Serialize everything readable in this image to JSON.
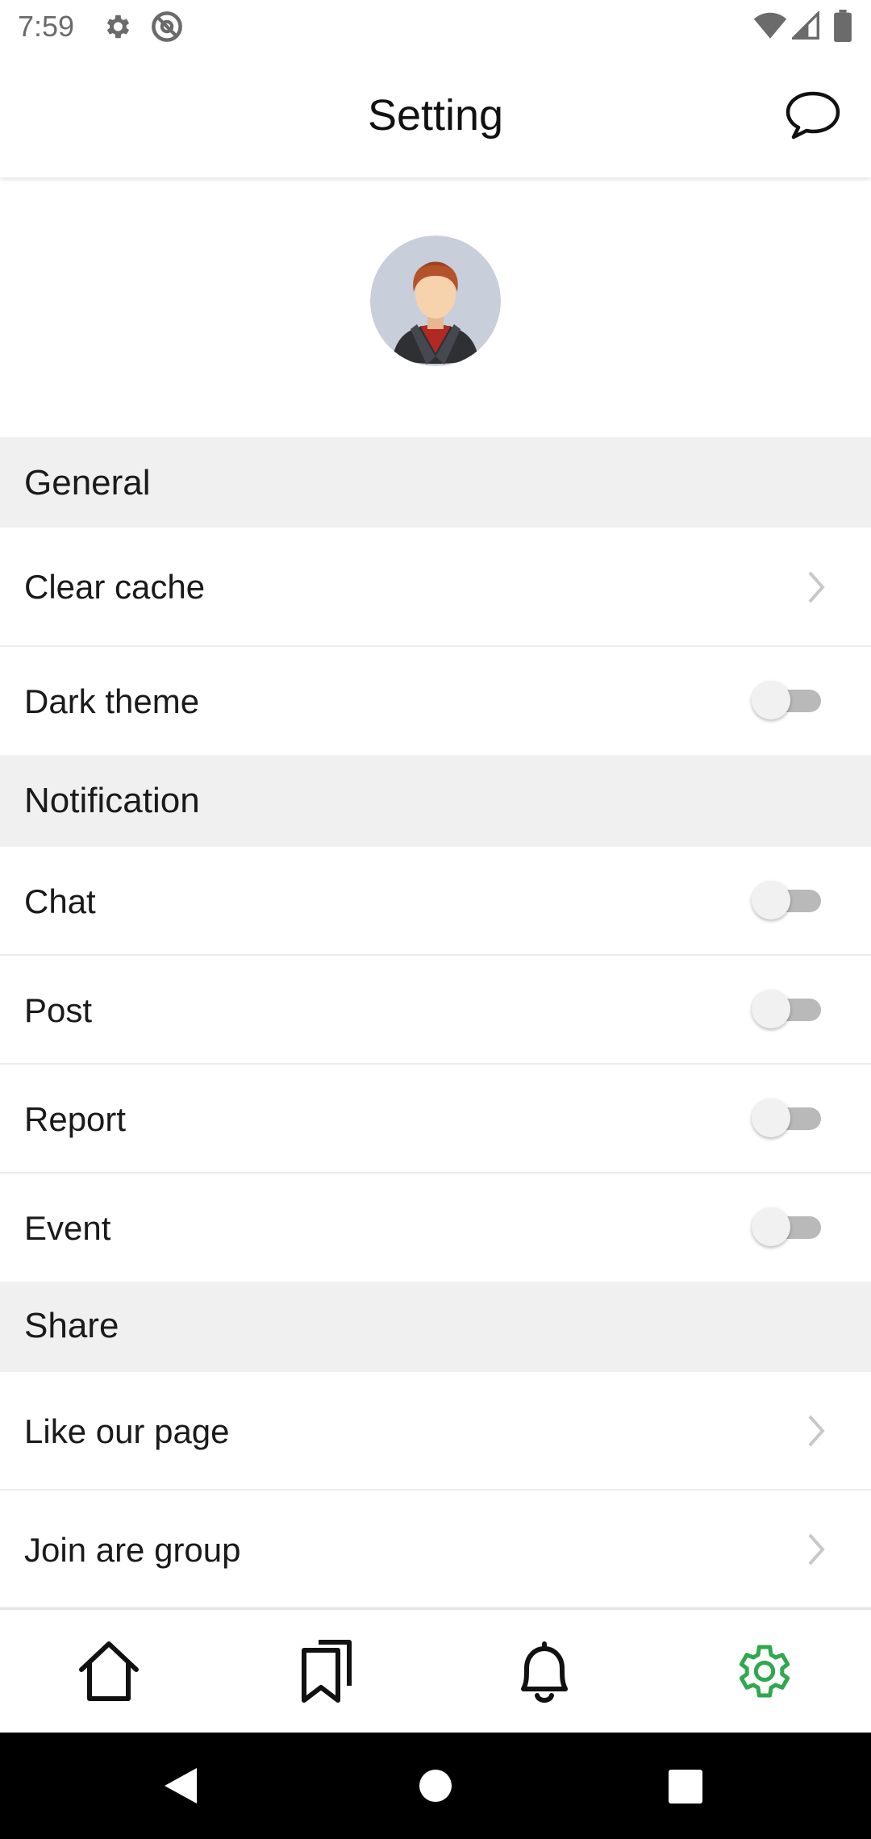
{
  "status_bar": {
    "time": "7:59",
    "left_icons": [
      "settings-icon",
      "at-sign-icon"
    ],
    "right_icons": [
      "wifi-icon",
      "cell-signal-icon",
      "battery-icon"
    ]
  },
  "header": {
    "title": "Setting",
    "action_icon": "chat-bubble-icon"
  },
  "profile": {
    "avatar_icon": "user-avatar"
  },
  "sections": {
    "general": {
      "title": "General",
      "items": {
        "clear_cache": {
          "label": "Clear cache",
          "control": "chevron"
        },
        "dark_theme": {
          "label": "Dark theme",
          "control": "toggle",
          "value": false
        }
      }
    },
    "notification": {
      "title": "Notification",
      "items": {
        "chat": {
          "label": "Chat",
          "control": "toggle",
          "value": false
        },
        "post": {
          "label": "Post",
          "control": "toggle",
          "value": false
        },
        "report": {
          "label": "Report",
          "control": "toggle",
          "value": false
        },
        "event": {
          "label": "Event",
          "control": "toggle",
          "value": false
        }
      }
    },
    "share": {
      "title": "Share",
      "items": {
        "like_page": {
          "label": "Like our page",
          "control": "chevron"
        },
        "join_group": {
          "label": "Join are group",
          "control": "chevron"
        }
      }
    }
  },
  "bottom_nav": {
    "items": [
      {
        "icon": "home-icon",
        "active": false
      },
      {
        "icon": "bookmarks-icon",
        "active": false
      },
      {
        "icon": "bell-icon",
        "active": false
      },
      {
        "icon": "gear-icon",
        "active": true
      }
    ],
    "active_color": "#2fa84f",
    "inactive_color": "#111111"
  },
  "system_nav": {
    "buttons": [
      "back-icon",
      "home-circle-icon",
      "recents-icon"
    ]
  },
  "colors": {
    "section_background": "#f0f0f0",
    "toggle_track_off": "#b9b9b9",
    "toggle_thumb_off": "#f1f1f1",
    "chevron": "#c8c8c8"
  }
}
